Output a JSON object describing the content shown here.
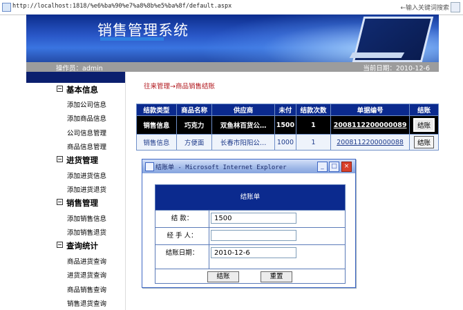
{
  "browser": {
    "url": "http://localhost:1818/%e6%ba%90%e7%a8%8b%e5%ba%8f/default.aspx",
    "search_placeholder": "←输入关键词搜索"
  },
  "header": {
    "title": "销售管理系统",
    "operator": "操作员：admin",
    "current_date": "当前日期：2010-12-6"
  },
  "sidebar": {
    "categories": [
      {
        "label": "基本信息",
        "items": [
          "添加公司信息",
          "添加商品信息",
          "公司信息管理",
          "商品信息管理"
        ]
      },
      {
        "label": "进货管理",
        "items": [
          "添加进货信息",
          "添加进货退货"
        ]
      },
      {
        "label": "销售管理",
        "items": [
          "添加销售信息",
          "添加销售退货"
        ]
      },
      {
        "label": "查询统计",
        "items": [
          "商品进货查询",
          "进货退货查询",
          "商品销售查询",
          "销售退货查询"
        ]
      }
    ]
  },
  "main": {
    "breadcrumb": "往来管理→商品销售结账",
    "table": {
      "headers": [
        "结款类型",
        "商品名称",
        "供应商",
        "未付",
        "结款次数",
        "单据编号",
        "结账"
      ],
      "rows": [
        {
          "type": "销售信息",
          "product": "巧克力",
          "supplier": "双鱼林百货公…",
          "unpaid": "1500",
          "count": "1",
          "doc_no": "2008112200000089",
          "action": "结账",
          "selected": true
        },
        {
          "type": "销售信息",
          "product": "方便面",
          "supplier": "长春市阳阳公…",
          "unpaid": "1000",
          "count": "1",
          "doc_no": "2008112200000088",
          "action": "结账",
          "selected": false
        }
      ]
    }
  },
  "dialog": {
    "title": "结账单 - Microsoft Internet Explorer",
    "form_title": "结账单",
    "fields": [
      {
        "label": "结    款：",
        "value": "1500"
      },
      {
        "label": "经 手 人：",
        "value": ""
      },
      {
        "label": "结账日期：",
        "value": "2010-12-6"
      }
    ],
    "submit_label": "结账",
    "reset_label": "重置"
  },
  "colors": {
    "banner_blue": "#1f4fbf",
    "header_navy": "#0b2a8e",
    "breadcrumb_red": "#b0141a",
    "status_gray": "#9c9c9c"
  }
}
